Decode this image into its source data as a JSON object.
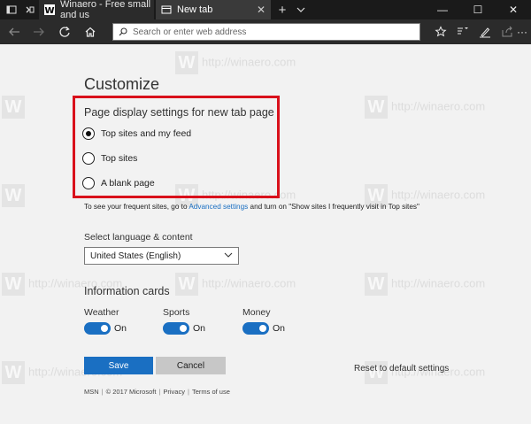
{
  "tabs": [
    {
      "title": "Winaero - Free small and us",
      "active": false
    },
    {
      "title": "New tab",
      "active": true
    }
  ],
  "window_controls": {
    "minimize": "—",
    "maximize": "☐",
    "close": "✕"
  },
  "addressbar": {
    "placeholder": "Search or enter web address"
  },
  "page": {
    "title": "Customize",
    "section_label": "Page display settings for new tab page",
    "options": [
      {
        "label": "Top sites and my feed",
        "checked": true
      },
      {
        "label": "Top sites",
        "checked": false
      },
      {
        "label": "A blank page",
        "checked": false
      }
    ],
    "info": {
      "pre": "To see your frequent sites, go to ",
      "link": "Advanced settings",
      "post": " and turn on \"Show sites I frequently visit in Top sites\""
    },
    "language": {
      "label": "Select language & content",
      "selected": "United States (English)"
    },
    "cards": {
      "title": "Information cards",
      "items": [
        {
          "label": "Weather",
          "state": "On"
        },
        {
          "label": "Sports",
          "state": "On"
        },
        {
          "label": "Money",
          "state": "On"
        }
      ]
    },
    "buttons": {
      "save": "Save",
      "cancel": "Cancel",
      "reset": "Reset to default settings"
    },
    "footer": {
      "brand": "MSN",
      "copyright": "© 2017 Microsoft",
      "privacy": "Privacy",
      "terms": "Terms of use"
    }
  },
  "watermark": "http://winaero.com",
  "colors": {
    "accent": "#1a6fc2",
    "highlight_border": "#d9101b",
    "titlebar": "#1a1a1a",
    "navbar": "#2b2b2b"
  }
}
